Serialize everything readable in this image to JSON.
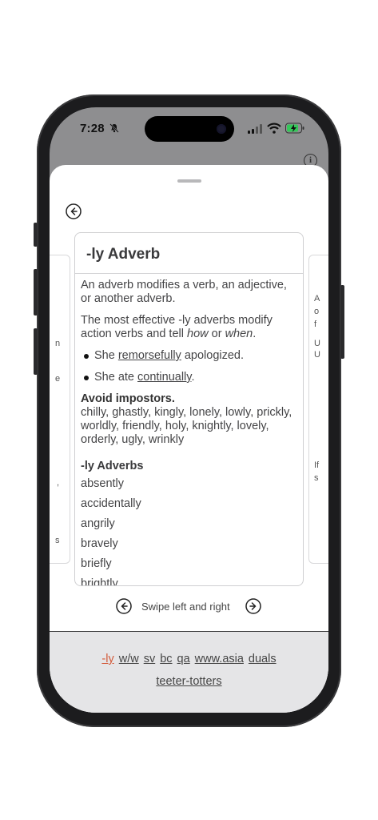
{
  "status_bar": {
    "time": "7:28"
  },
  "icons": {
    "bell": "bell-slash-icon",
    "signal": "cellular-signal-icon",
    "wifi": "wifi-icon",
    "battery": "battery-charging-icon",
    "info": "info-icon",
    "back": "arrow-left-circle-icon",
    "prev": "arrow-left-circle-icon",
    "next": "arrow-right-circle-icon"
  },
  "info_glyph": "i",
  "card": {
    "title": "-ly Adverb",
    "intro": "An adverb modifies a verb, an adjective, or another adverb.",
    "effective_prefix": "The most effective -ly adverbs modify action verbs and tell ",
    "effective_how": "how",
    "effective_or": " or ",
    "effective_when": "when",
    "effective_end": ".",
    "examples": [
      {
        "before": "She ",
        "link": "remorsefully",
        "after": " apologized."
      },
      {
        "before": "She ate ",
        "link": "continually",
        "after": "."
      }
    ],
    "impostors_title": "Avoid impostors.",
    "impostors_list": "chilly, ghastly, kingly, lonely, lowly, prickly, worldly, friendly, holy, knightly, lovely, orderly, ugly, wrinkly",
    "adverbs_title": "-ly Adverbs",
    "adverbs": [
      "absently",
      "accidentally",
      "angrily",
      "bravely",
      "briefly",
      "brightly"
    ]
  },
  "side_fragments": {
    "left": [
      "n",
      "e",
      ",",
      "s"
    ],
    "right": [
      "A",
      "o",
      "f",
      "U",
      "U",
      "If",
      "s"
    ]
  },
  "swipe_hint": "Swipe left and right",
  "footer_links": [
    "-ly",
    "w/w",
    "sv",
    "bc",
    "qa",
    "www.asia",
    "duals",
    "teeter-totters"
  ],
  "colors": {
    "active_link": "#d35a3a",
    "footer_bg": "#e5e5e7",
    "sheet_bg": "#ffffff"
  }
}
